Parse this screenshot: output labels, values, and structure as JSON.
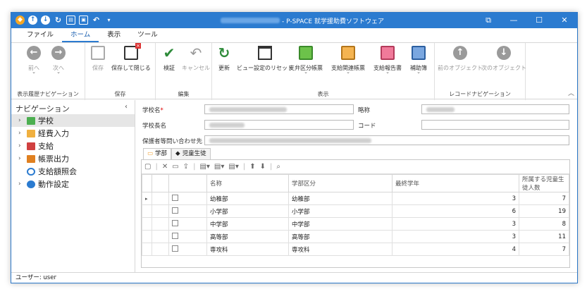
{
  "window": {
    "title": "- P-SPACE 就学援助費ソフトウェア",
    "buttons": [
      "⧉",
      "—",
      "☐",
      "✕"
    ]
  },
  "menu": [
    "ファイル",
    "ホーム",
    "表示",
    "ツール"
  ],
  "ribbon": {
    "groups": [
      "表示履歴ナビゲーション",
      "保存",
      "編集",
      "表示",
      "レコードナビゲーション"
    ],
    "buttons": {
      "back": "前へ",
      "forward": "次へ",
      "save": "保存",
      "save_close": "保存して閉じる",
      "verify": "検証",
      "cancel": "キャンセル",
      "refresh": "更新",
      "reset_view": "ビュー設定のリセット",
      "pay_cat": "支弁区分帳票",
      "pay_rel": "支給関連帳票",
      "pay_report": "支給報告書",
      "aux_book": "補助簿",
      "prev_obj": "前のオブジェクト",
      "next_obj": "次のオブジェクト"
    }
  },
  "nav": {
    "title": "ナビゲーション",
    "items": [
      {
        "label": "学校",
        "color": "#4caf50"
      },
      {
        "label": "経費入力",
        "color": "#f0a030"
      },
      {
        "label": "支給",
        "color": "#d04040"
      },
      {
        "label": "帳票出力",
        "color": "#e08020"
      },
      {
        "label": "支給額照会",
        "color": "#2b7bd0"
      },
      {
        "label": "動作設定",
        "color": "#2b7bd0"
      }
    ]
  },
  "form": {
    "school_name": "学校名",
    "required_mark": "*",
    "short_name": "略称",
    "principal": "学校長名",
    "code": "コード",
    "contact": "保護者等問い合わせ先"
  },
  "tabs": [
    "学部",
    "児童生徒"
  ],
  "table": {
    "headers": [
      "名称",
      "学部区分",
      "最終学年",
      "所属する児童生徒人数"
    ],
    "rows": [
      {
        "name": "幼稚部",
        "cat": "幼稚部",
        "grade": "3",
        "count": "7"
      },
      {
        "name": "小学部",
        "cat": "小学部",
        "grade": "6",
        "count": "19"
      },
      {
        "name": "中学部",
        "cat": "中学部",
        "grade": "3",
        "count": "8"
      },
      {
        "name": "高等部",
        "cat": "高等部",
        "grade": "3",
        "count": "11"
      },
      {
        "name": "専攻科",
        "cat": "専攻科",
        "grade": "4",
        "count": "7"
      }
    ]
  },
  "status": "ユーザー: user"
}
